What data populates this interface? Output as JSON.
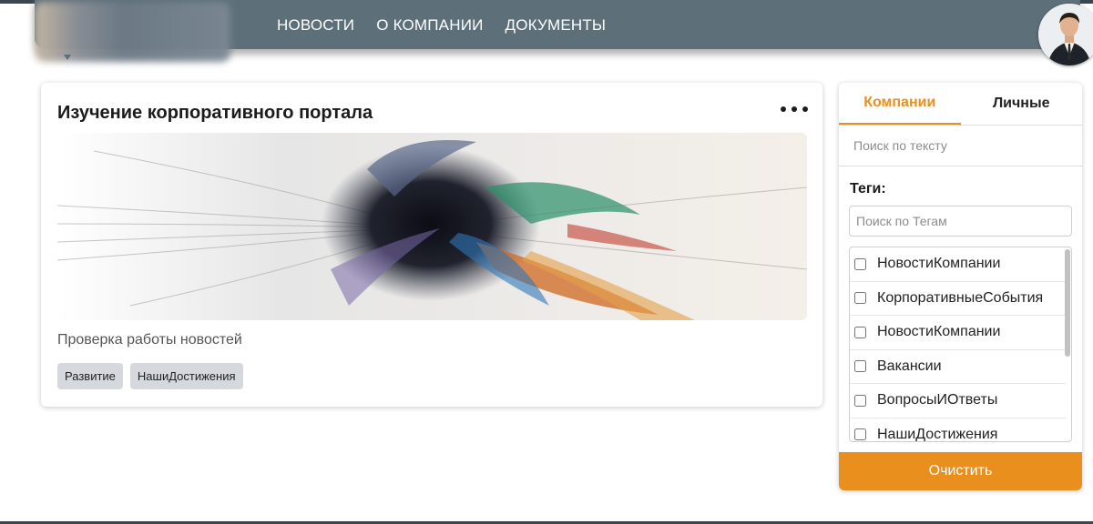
{
  "header": {
    "nav": [
      {
        "label": "НОВОСТИ"
      },
      {
        "label": "О КОМПАНИИ"
      },
      {
        "label": "ДОКУМЕНТЫ"
      }
    ],
    "bar_color": "#5d6f79"
  },
  "post": {
    "title": "Изучение корпоративного портала",
    "description": "Проверка работы новостей",
    "tags": [
      "Развитие",
      "НашиДостижения"
    ]
  },
  "sidebar": {
    "tabs": [
      {
        "label": "Компании",
        "active": true
      },
      {
        "label": "Личные",
        "active": false
      }
    ],
    "search_placeholder": "Поиск по тексту",
    "tags_label": "Теги:",
    "tag_search_placeholder": "Поиск по Тегам",
    "tag_options": [
      "НовостиКомпании",
      "КорпоративныеСобытия",
      "НовостиКомпании",
      "Вакансии",
      "ВопросыИОтветы",
      "НашиДостижения"
    ],
    "clear_label": "Очистить",
    "accent_color": "#e88f1d"
  }
}
